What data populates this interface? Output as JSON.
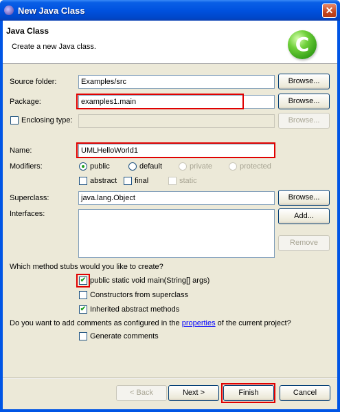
{
  "window": {
    "title": "New Java Class",
    "close_glyph": "✕"
  },
  "banner": {
    "title": "Java Class",
    "description": "Create a new Java class.",
    "logo_letter": "C"
  },
  "source_folder": {
    "label": "Source folder:",
    "value": "Examples/src",
    "browse": "Browse..."
  },
  "package": {
    "label": "Package:",
    "value": "examples1.main",
    "browse": "Browse..."
  },
  "enclosing_type": {
    "label": "Enclosing type:",
    "value": "",
    "browse": "Browse..."
  },
  "name": {
    "label": "Name:",
    "value": "UMLHelloWorld1"
  },
  "modifiers": {
    "label": "Modifiers:",
    "access": [
      "public",
      "default",
      "private",
      "protected"
    ],
    "selected": "public",
    "others": [
      "abstract",
      "final",
      "static"
    ]
  },
  "superclass": {
    "label": "Superclass:",
    "value": "java.lang.Object",
    "browse": "Browse..."
  },
  "interfaces": {
    "label": "Interfaces:",
    "add": "Add...",
    "remove": "Remove"
  },
  "stubs": {
    "question": "Which method stubs would you like to create?",
    "main": "public static void main(String[] args)",
    "constructors": "Constructors from superclass",
    "inherited": "Inherited abstract methods",
    "checked": [
      true,
      false,
      true
    ]
  },
  "comments": {
    "question_pre": "Do you want to add comments as configured in the ",
    "link": "properties",
    "question_post": " of the current project?",
    "generate": "Generate comments"
  },
  "footer": {
    "back": "< Back",
    "next": "Next >",
    "finish": "Finish",
    "cancel": "Cancel"
  },
  "colors": {
    "highlight": "#e00000",
    "titlebar": "#0052df",
    "dialog_bg": "#ece9d8"
  }
}
